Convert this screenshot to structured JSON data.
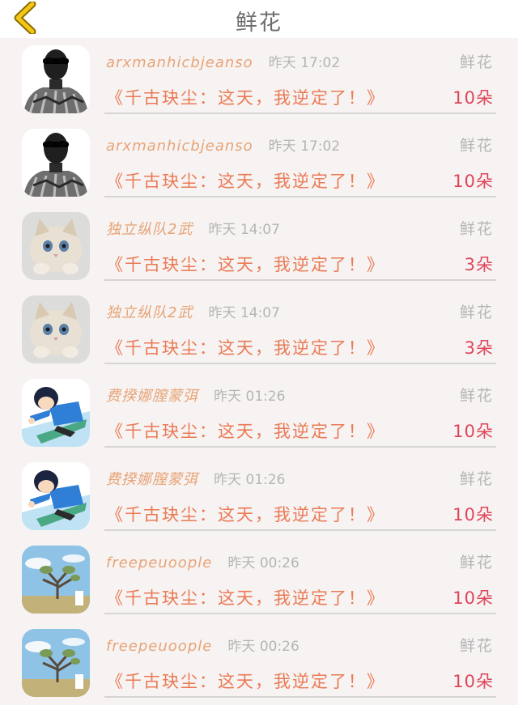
{
  "header": {
    "title": "鲜花",
    "back_icon": "chevron-left-icon",
    "accent_color": "#f2c619"
  },
  "items": [
    {
      "avatar": "man-sunglasses-avatar",
      "username": "arxmanhicbjeanso",
      "time": "昨天 17:02",
      "gift_type": "鲜花",
      "message": "《千古玦尘：这天，我逆定了！》",
      "quantity": "10朵"
    },
    {
      "avatar": "man-sunglasses-avatar",
      "username": "arxmanhicbjeanso",
      "time": "昨天 17:02",
      "gift_type": "鲜花",
      "message": "《千古玦尘：这天，我逆定了！》",
      "quantity": "10朵"
    },
    {
      "avatar": "cat-avatar",
      "username": "独立纵队2武",
      "time": "昨天 14:07",
      "gift_type": "鲜花",
      "message": "《千古玦尘：这天，我逆定了！》",
      "quantity": "3朵"
    },
    {
      "avatar": "cat-avatar",
      "username": "独立纵队2武",
      "time": "昨天 14:07",
      "gift_type": "鲜花",
      "message": "《千古玦尘：这天，我逆定了！》",
      "quantity": "3朵"
    },
    {
      "avatar": "anime-boy-avatar",
      "username": "费揆娜膣蒙弭",
      "time": "昨天 01:26",
      "gift_type": "鲜花",
      "message": "《千古玦尘：这天，我逆定了！》",
      "quantity": "10朵"
    },
    {
      "avatar": "anime-boy-avatar",
      "username": "费揆娜膣蒙弭",
      "time": "昨天 01:26",
      "gift_type": "鲜花",
      "message": "《千古玦尘：这天，我逆定了！》",
      "quantity": "10朵"
    },
    {
      "avatar": "tree-landscape-avatar",
      "username": "freepeuoople",
      "time": "昨天 00:26",
      "gift_type": "鲜花",
      "message": "《千古玦尘：这天，我逆定了！》",
      "quantity": "10朵"
    },
    {
      "avatar": "tree-landscape-avatar",
      "username": "freepeuoople",
      "time": "昨天 00:26",
      "gift_type": "鲜花",
      "message": "《千古玦尘：这天，我逆定了！》",
      "quantity": "10朵"
    }
  ]
}
